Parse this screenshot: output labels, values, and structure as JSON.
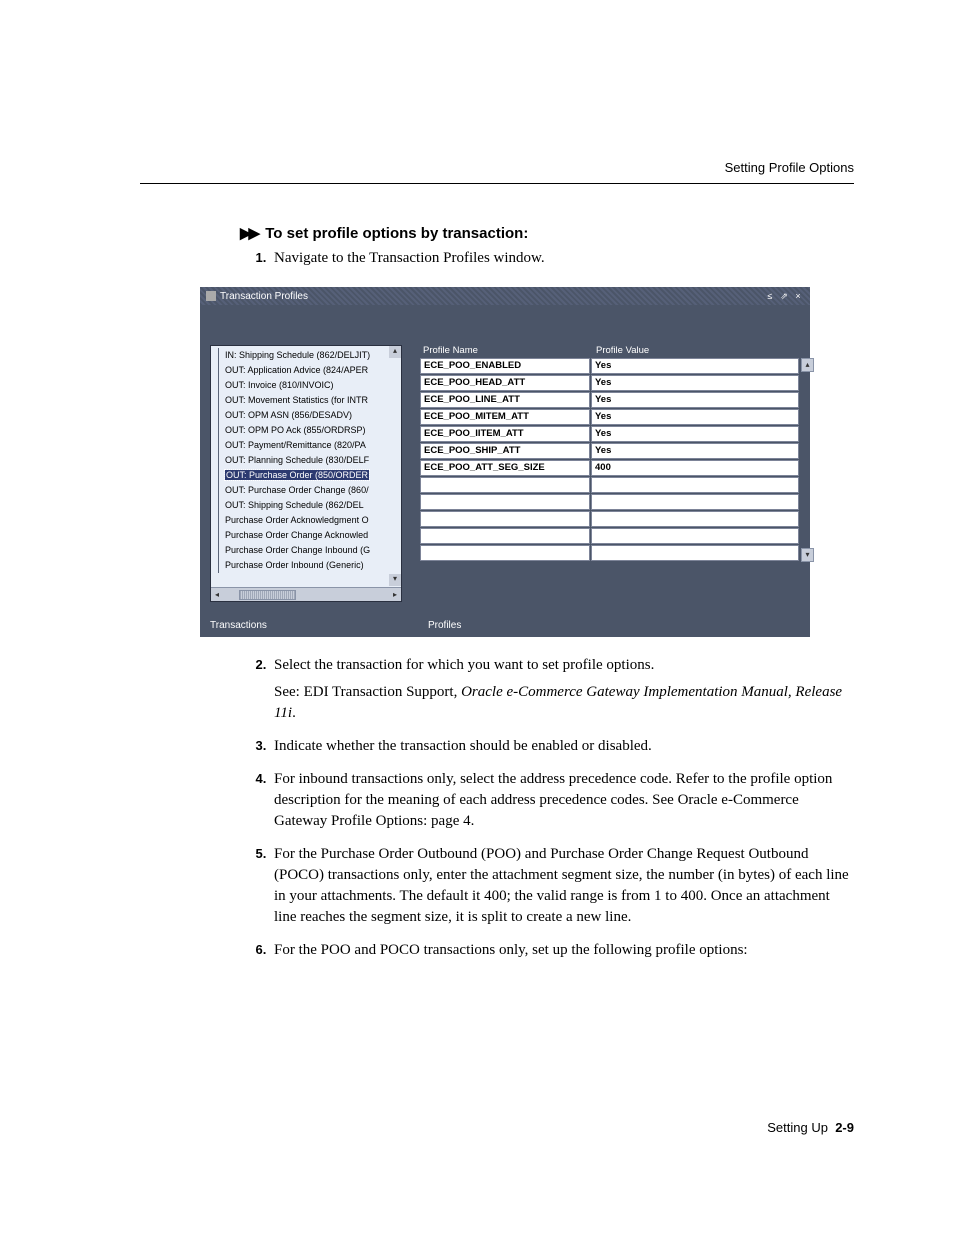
{
  "header": {
    "running": "Setting Profile Options"
  },
  "heading": "To set profile options by transaction:",
  "step1": "Navigate to the Transaction Profiles window.",
  "screenshot": {
    "title": "Transaction Profiles",
    "tree": [
      "IN: Shipping Schedule (862/DELJIT)",
      "OUT: Application Advice (824/APER",
      "OUT: Invoice (810/INVOIC)",
      "OUT: Movement Statistics (for INTR",
      "OUT: OPM ASN (856/DESADV)",
      "OUT: OPM PO Ack (855/ORDRSP)",
      "OUT: Payment/Remittance (820/PA",
      "OUT: Planning Schedule (830/DELF",
      "OUT: Purchase Order (850/ORDER",
      "OUT: Purchase Order Change (860/",
      "OUT: Shipping Schedule (862/DEL",
      "Purchase Order Acknowledgment O",
      "Purchase Order Change Acknowled",
      "Purchase Order Change Inbound (G",
      "Purchase Order Inbound (Generic)"
    ],
    "selected_index": 8,
    "grid_headers": {
      "name": "Profile Name",
      "value": "Profile Value"
    },
    "grid_rows": [
      {
        "name": "ECE_POO_ENABLED",
        "value": "Yes"
      },
      {
        "name": "ECE_POO_HEAD_ATT",
        "value": "Yes"
      },
      {
        "name": "ECE_POO_LINE_ATT",
        "value": "Yes"
      },
      {
        "name": "ECE_POO_MITEM_ATT",
        "value": "Yes"
      },
      {
        "name": "ECE_POO_IITEM_ATT",
        "value": "Yes"
      },
      {
        "name": "ECE_POO_SHIP_ATT",
        "value": "Yes"
      },
      {
        "name": "ECE_POO_ATT_SEG_SIZE",
        "value": "400"
      },
      {
        "name": "",
        "value": ""
      },
      {
        "name": "",
        "value": ""
      },
      {
        "name": "",
        "value": ""
      },
      {
        "name": "",
        "value": ""
      },
      {
        "name": "",
        "value": ""
      }
    ],
    "footer_left": "Transactions",
    "footer_right": "Profiles"
  },
  "step2": "Select the transaction for which you want to set profile options.",
  "step2b_a": "See: EDI Transaction Support, ",
  "step2b_em": "Oracle e-Commerce Gateway Implementation Manual, Release 11i",
  "step2b_c": ".",
  "step3": "Indicate whether the transaction should be enabled or disabled.",
  "step4": "For inbound transactions only, select the address precedence code. Refer to the profile option description for the meaning of each address precedence codes. See Oracle e-Commerce Gateway Profile Options: page 4.",
  "step5": "For the Purchase Order Outbound (POO) and Purchase Order Change Request Outbound (POCO) transactions only, enter the attachment segment size, the number (in bytes) of each line in your attachments.  The default it 400; the valid range is from 1 to 400.  Once an attachment line reaches the segment size, it is split to create a new line.",
  "step6": "For the POO and POCO transactions only, set up the following profile options:",
  "footer": {
    "section": "Setting Up",
    "page": "2-9"
  }
}
